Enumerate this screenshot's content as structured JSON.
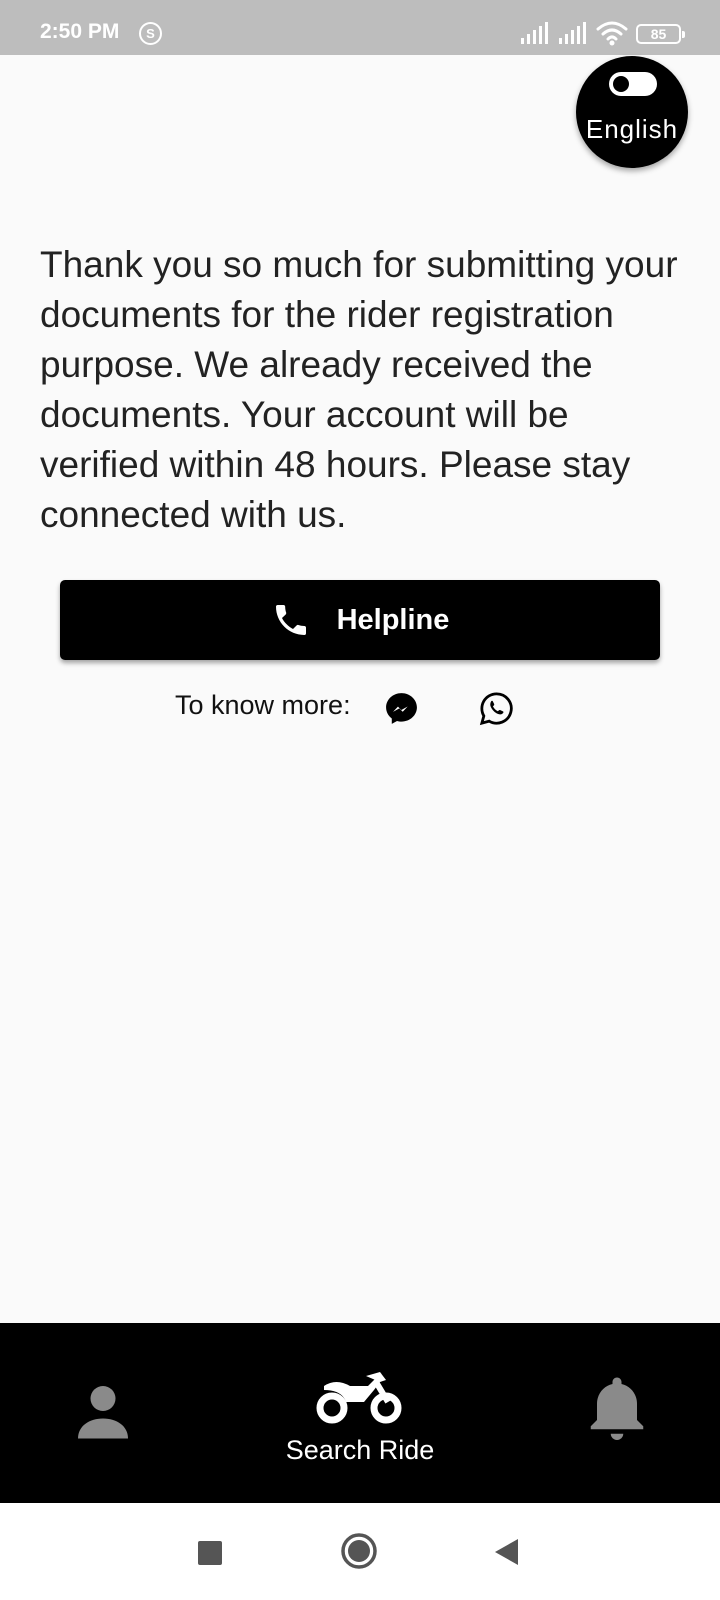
{
  "status_bar": {
    "time": "2:50 PM",
    "battery": "85"
  },
  "language_toggle": {
    "label": "English"
  },
  "message": "Thank you so much for submitting your documents for the rider registration purpose. We already received the documents. Your account will be verified within 48 hours. Please stay connected with us.",
  "helpline_button": {
    "label": "Helpline",
    "icon": "phone-icon"
  },
  "contact": {
    "label": "To know more:",
    "icons": [
      "messenger-icon",
      "whatsapp-icon"
    ]
  },
  "bottom_nav": {
    "items": [
      {
        "icon": "profile-icon",
        "label": ""
      },
      {
        "icon": "motorcycle-icon",
        "label": "Search Ride"
      },
      {
        "icon": "bell-icon",
        "label": ""
      }
    ]
  },
  "colors": {
    "primary": "#000000",
    "background": "#fafafa",
    "status_bar": "#bdbdbd",
    "inactive_icon": "#8a8a8a"
  }
}
